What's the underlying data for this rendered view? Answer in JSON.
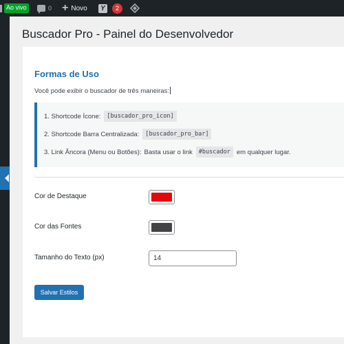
{
  "admin_bar": {
    "live_label": "Ao vivo",
    "comments_count": "0",
    "new_label": "Novo",
    "yoast_letter": "Y",
    "yoast_badge": "2"
  },
  "page": {
    "title": "Buscador Pro - Painel do Desenvolvedor"
  },
  "usage": {
    "title": "Formas de Uso",
    "intro": "Você pode exibir o buscador de três maneiras:",
    "items": [
      {
        "label": "1. Shortcode Ícone:",
        "code": "[buscador_pro_icon]",
        "suffix": ""
      },
      {
        "label": "2. Shortcode Barra Centralizada:",
        "code": "[buscador_pro_bar]",
        "suffix": ""
      },
      {
        "label": "3. Link Âncora (Menu ou Botões):",
        "pre": "Basta usar o link",
        "code": "#buscador",
        "suffix": "em qualquer lugar."
      }
    ]
  },
  "settings": {
    "highlight_label": "Cor de Destaque",
    "highlight_color": "#e5070b",
    "font_color_label": "Cor das Fontes",
    "font_color": "#444444",
    "text_size_label": "Tamanho do Texto (px)",
    "text_size_value": "14",
    "save_label": "Salvar Estilos"
  },
  "colors": {
    "accent": "#2271b1",
    "admin_bar": "#1d2327",
    "live": "#00a32a",
    "notification": "#d63638"
  }
}
